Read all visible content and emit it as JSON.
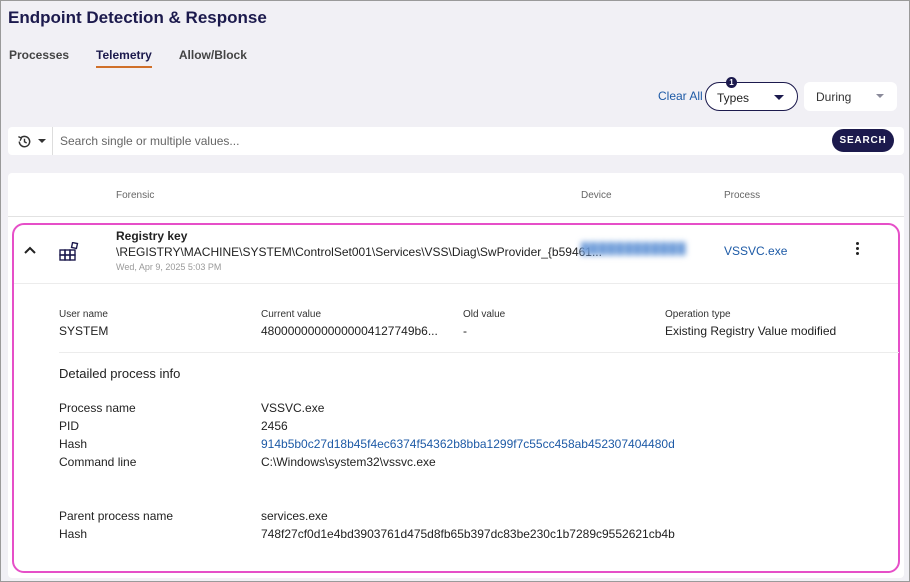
{
  "app": {
    "title": "Endpoint Detection & Response"
  },
  "tabs": [
    {
      "label": "Processes",
      "active": false
    },
    {
      "label": "Telemetry",
      "active": true
    },
    {
      "label": "Allow/Block",
      "active": false
    }
  ],
  "filters": {
    "clear_all": "Clear All",
    "types": {
      "label": "Types",
      "badge": "1"
    },
    "during": {
      "label": "During"
    }
  },
  "search": {
    "placeholder": "Search single or multiple values...",
    "button": "SEARCH",
    "history_icon": "history-icon"
  },
  "table": {
    "columns": {
      "forensic": "Forensic",
      "device": "Device",
      "process": "Process"
    },
    "row": {
      "title": "Registry key",
      "path": "\\REGISTRY\\MACHINE\\SYSTEM\\ControlSet001\\Services\\VSS\\Diag\\SwProvider_{b59461...",
      "timestamp": "Wed, Apr 9, 2025 5:03 PM",
      "device": "████████████",
      "process": "VSSVC.exe",
      "details": {
        "user_name_label": "User name",
        "user_name": "SYSTEM",
        "current_value_label": "Current value",
        "current_value": "48000000000000004127749b6...",
        "old_value_label": "Old value",
        "old_value": "-",
        "operation_type_label": "Operation type",
        "operation_type": "Existing Registry Value modified"
      },
      "process_info": {
        "section_title": "Detailed process info",
        "process_name_label": "Process name",
        "process_name": "VSSVC.exe",
        "pid_label": "PID",
        "pid": "2456",
        "hash_label": "Hash",
        "hash": "914b5b0c27d18b45f4ec6374f54362b8bba1299f7c55cc458ab452307404480d",
        "command_line_label": "Command line",
        "command_line": "C:\\Windows\\system32\\vssvc.exe",
        "parent_process_name_label": "Parent process name",
        "parent_process_name": "services.exe",
        "parent_hash_label": "Hash",
        "parent_hash": "748f27cf0d1e4bd3903761d475d8fb65b397dc83be230c1b7289c9552621cb4b"
      }
    }
  },
  "colors": {
    "brand_dark": "#1c1a4d",
    "link": "#1d5aa6",
    "tab_accent": "#d0702a",
    "highlight_border": "#e64fc8"
  }
}
